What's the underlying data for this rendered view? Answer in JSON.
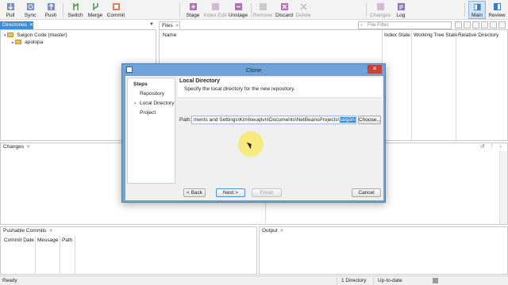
{
  "toolbar": {
    "items": [
      {
        "label": "Pull",
        "icon": "pull-icon"
      },
      {
        "label": "Sync",
        "icon": "sync-icon"
      },
      {
        "label": "Push",
        "icon": "push-icon"
      },
      {
        "label": "Switch",
        "icon": "switch-icon"
      },
      {
        "label": "Merge",
        "icon": "merge-icon"
      },
      {
        "label": "Commit",
        "icon": "commit-icon"
      },
      {
        "label": "Stage",
        "icon": "stage-icon"
      },
      {
        "label": "Index Edit",
        "icon": "index-edit-icon",
        "disabled": true
      },
      {
        "label": "Unstage",
        "icon": "unstage-icon"
      },
      {
        "label": "Remove",
        "icon": "remove-icon",
        "disabled": true
      },
      {
        "label": "Discard",
        "icon": "discard-icon"
      },
      {
        "label": "Delete",
        "icon": "delete-icon",
        "disabled": true
      },
      {
        "label": "Changes",
        "icon": "changes-icon",
        "disabled": true
      },
      {
        "label": "Log",
        "icon": "log-icon"
      },
      {
        "label": "Main",
        "icon": "main-icon",
        "active": true
      },
      {
        "label": "Review",
        "icon": "review-icon"
      }
    ]
  },
  "directories": {
    "tab": "Directories",
    "tree": [
      "Saigon Code (master)",
      "apolopa"
    ]
  },
  "files": {
    "tab": "Files",
    "filter_placeholder": "File Filter",
    "columns": [
      "Name",
      "Index State",
      "Working Tree State",
      "Relative Directory"
    ]
  },
  "changes": {
    "tab": "Changes"
  },
  "pushable": {
    "tab": "Pushable Commits",
    "columns": [
      "Commit Date",
      "Message",
      "Path"
    ]
  },
  "output": {
    "tab": "Output"
  },
  "status": {
    "left": "Ready",
    "directories": "1 Directory",
    "sync": "Up-to-date"
  },
  "dialog": {
    "title": "Clone",
    "steps_heading": "Steps",
    "steps": [
      "Repository",
      "Local Directory",
      "Project"
    ],
    "current_step": "Local Directory",
    "heading": "Local Directory",
    "description": "Specify the local directory for the new repository.",
    "path_label": "Path:",
    "path_prefix": "ments and Settings\\Kimhieuqtvn\\Documents\\NetBeansProjects\\",
    "path_selected": "saigon-code",
    "choose_label": "Choose...",
    "back_label": "< Back",
    "next_label": "Next >",
    "finish_label": "Finish",
    "cancel_label": "Cancel"
  },
  "colors": {
    "accent": "#3c8ed8",
    "dialog_frame": "#6fa2d8",
    "close_button": "#c8403a"
  }
}
